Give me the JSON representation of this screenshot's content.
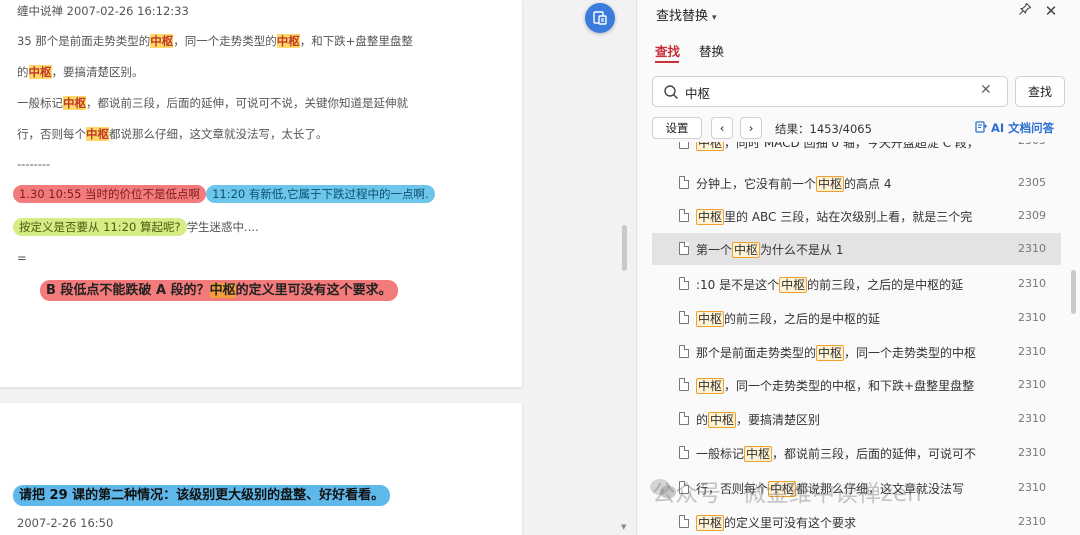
{
  "document": {
    "page1": {
      "line1": "缠中说禅 2007-02-26 16:12:33",
      "line2": {
        "a": "35 那个是前面走势类型的",
        "k1": "中枢",
        "b": "，同一个走势类型的",
        "k2": "中枢",
        "c": "，和下跌+盘整里盘整"
      },
      "line3": {
        "a": "的",
        "k": "中枢",
        "b": "，要搞清楚区别。"
      },
      "line4": {
        "a": "一般标记",
        "k": "中枢",
        "b": "，都说前三段，后面的延伸，可说可不说，关键你知道是延伸就"
      },
      "line5": {
        "a": "行，否则每个",
        "k": "中枢",
        "b": "都说那么仔细，这文章就没法写，太长了。"
      },
      "separator": "--------",
      "pill_red": "1.30 10:55 当时的价位不是低点啊",
      "pill_blue": "11:20 有新低,它属于下跌过程中的一点啊.",
      "pill_green": "按定义是否要从 11:20 算起呢?",
      "after_green": "学生迷惑中....",
      "equals": "=",
      "bold_line": {
        "a": "B 段低点不能跌破 A 段的？",
        "k": "中枢",
        "b": "的定义里可没有这个要求。"
      }
    },
    "page2": {
      "bold_line": "请把 29 课的第二种情况：该级别更大级别的盘整、好好看看。",
      "date": "2007-2-26  16:50"
    }
  },
  "panel": {
    "title": "查找替换",
    "tabs": {
      "find": "查找",
      "replace": "替换"
    },
    "search": {
      "value": "中枢",
      "placeholder": ""
    },
    "find_button": "查找",
    "settings_button": "设置",
    "result_label": "结果：1453/4065",
    "ai_link": "AI 文档问答",
    "results": [
      {
        "a": "",
        "k": "中枢",
        "b": "，同时 MACD 回抽 0 轴，今天开盘超淀 C 段，",
        "page": "2305"
      },
      {
        "a": "分钟上，它没有前一个",
        "k": "中枢",
        "b": "的高点 4",
        "page": "2305"
      },
      {
        "a": "",
        "k": "中枢",
        "b": "里的 ABC 三段，站在次级别上看，就是三个完",
        "page": "2309"
      },
      {
        "a": "第一个",
        "k": "中枢",
        "b": "为什么不是从 1",
        "page": "2310"
      },
      {
        "a": ":10 是不是这个",
        "k": "中枢",
        "b": "的前三段，之后的是中枢的延",
        "page": "2310"
      },
      {
        "a": "",
        "k": "中枢",
        "b": "的前三段，之后的是中枢的延",
        "page": "2310"
      },
      {
        "a": "那个是前面走势类型的",
        "k": "中枢",
        "b": "，同一个走势类型的中枢",
        "page": "2310"
      },
      {
        "a": "",
        "k": "中枢",
        "b": "，同一个走势类型的中枢，和下跌+盘整里盘整",
        "page": "2310"
      },
      {
        "a": "的",
        "k": "中枢",
        "b": "，要搞清楚区别",
        "page": "2310"
      },
      {
        "a": "一般标记",
        "k": "中枢",
        "b": "，都说前三段，后面的延伸，可说可不",
        "page": "2310"
      },
      {
        "a": "行，否则每个",
        "k": "中枢",
        "b": "都说那么仔细，这文章就没法写",
        "page": "2310"
      },
      {
        "a": "",
        "k": "中枢",
        "b": "的定义里可没有这个要求",
        "page": "2310"
      }
    ],
    "active_result_index": 3
  },
  "watermark": "公众号 · 微金维中读禅zen",
  "colors": {
    "accent_red": "#c8303a",
    "link_blue": "#2c6fd1",
    "highlight_yellow": "#ffd866",
    "pill_red": "#f47b7b",
    "pill_blue": "#6cc6ec",
    "pill_green": "#d6ec84",
    "keyword_border": "#f0a030"
  },
  "icons": [
    "convert-doc-icon",
    "pin-icon",
    "close-icon",
    "search-icon",
    "clear-icon",
    "chevron-left-icon",
    "chevron-right-icon",
    "ai-doc-icon",
    "doc-icon"
  ]
}
